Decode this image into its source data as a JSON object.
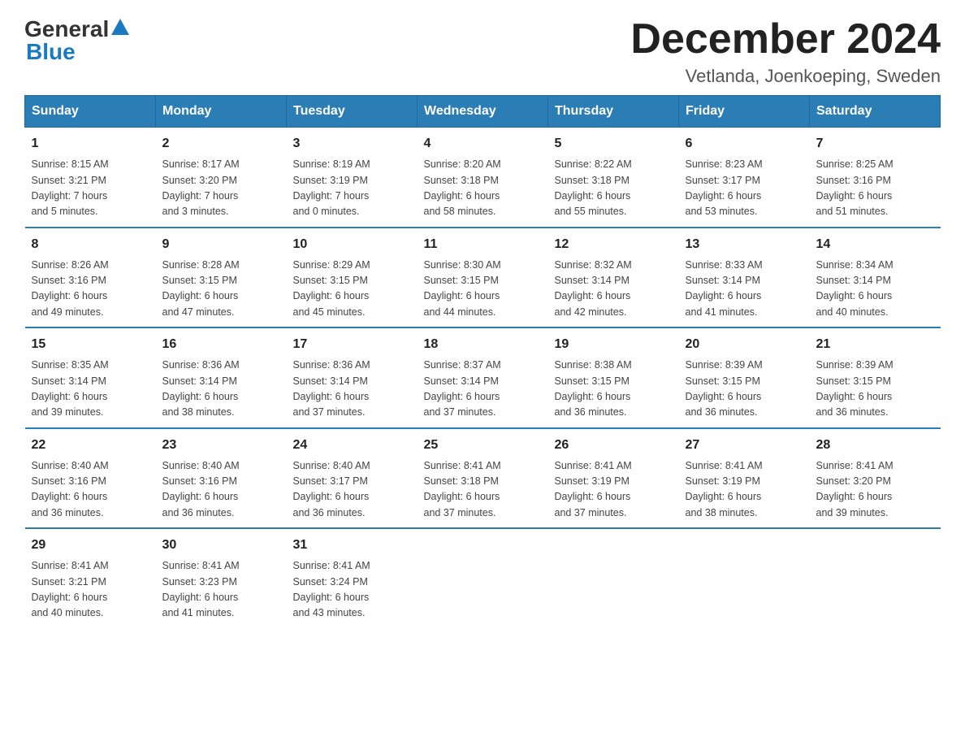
{
  "header": {
    "logo_general": "General",
    "logo_blue": "Blue",
    "month_title": "December 2024",
    "location": "Vetlanda, Joenkoeping, Sweden"
  },
  "days_of_week": [
    "Sunday",
    "Monday",
    "Tuesday",
    "Wednesday",
    "Thursday",
    "Friday",
    "Saturday"
  ],
  "weeks": [
    [
      {
        "day": "1",
        "sunrise": "8:15 AM",
        "sunset": "3:21 PM",
        "daylight": "7 hours and 5 minutes."
      },
      {
        "day": "2",
        "sunrise": "8:17 AM",
        "sunset": "3:20 PM",
        "daylight": "7 hours and 3 minutes."
      },
      {
        "day": "3",
        "sunrise": "8:19 AM",
        "sunset": "3:19 PM",
        "daylight": "7 hours and 0 minutes."
      },
      {
        "day": "4",
        "sunrise": "8:20 AM",
        "sunset": "3:18 PM",
        "daylight": "6 hours and 58 minutes."
      },
      {
        "day": "5",
        "sunrise": "8:22 AM",
        "sunset": "3:18 PM",
        "daylight": "6 hours and 55 minutes."
      },
      {
        "day": "6",
        "sunrise": "8:23 AM",
        "sunset": "3:17 PM",
        "daylight": "6 hours and 53 minutes."
      },
      {
        "day": "7",
        "sunrise": "8:25 AM",
        "sunset": "3:16 PM",
        "daylight": "6 hours and 51 minutes."
      }
    ],
    [
      {
        "day": "8",
        "sunrise": "8:26 AM",
        "sunset": "3:16 PM",
        "daylight": "6 hours and 49 minutes."
      },
      {
        "day": "9",
        "sunrise": "8:28 AM",
        "sunset": "3:15 PM",
        "daylight": "6 hours and 47 minutes."
      },
      {
        "day": "10",
        "sunrise": "8:29 AM",
        "sunset": "3:15 PM",
        "daylight": "6 hours and 45 minutes."
      },
      {
        "day": "11",
        "sunrise": "8:30 AM",
        "sunset": "3:15 PM",
        "daylight": "6 hours and 44 minutes."
      },
      {
        "day": "12",
        "sunrise": "8:32 AM",
        "sunset": "3:14 PM",
        "daylight": "6 hours and 42 minutes."
      },
      {
        "day": "13",
        "sunrise": "8:33 AM",
        "sunset": "3:14 PM",
        "daylight": "6 hours and 41 minutes."
      },
      {
        "day": "14",
        "sunrise": "8:34 AM",
        "sunset": "3:14 PM",
        "daylight": "6 hours and 40 minutes."
      }
    ],
    [
      {
        "day": "15",
        "sunrise": "8:35 AM",
        "sunset": "3:14 PM",
        "daylight": "6 hours and 39 minutes."
      },
      {
        "day": "16",
        "sunrise": "8:36 AM",
        "sunset": "3:14 PM",
        "daylight": "6 hours and 38 minutes."
      },
      {
        "day": "17",
        "sunrise": "8:36 AM",
        "sunset": "3:14 PM",
        "daylight": "6 hours and 37 minutes."
      },
      {
        "day": "18",
        "sunrise": "8:37 AM",
        "sunset": "3:14 PM",
        "daylight": "6 hours and 37 minutes."
      },
      {
        "day": "19",
        "sunrise": "8:38 AM",
        "sunset": "3:15 PM",
        "daylight": "6 hours and 36 minutes."
      },
      {
        "day": "20",
        "sunrise": "8:39 AM",
        "sunset": "3:15 PM",
        "daylight": "6 hours and 36 minutes."
      },
      {
        "day": "21",
        "sunrise": "8:39 AM",
        "sunset": "3:15 PM",
        "daylight": "6 hours and 36 minutes."
      }
    ],
    [
      {
        "day": "22",
        "sunrise": "8:40 AM",
        "sunset": "3:16 PM",
        "daylight": "6 hours and 36 minutes."
      },
      {
        "day": "23",
        "sunrise": "8:40 AM",
        "sunset": "3:16 PM",
        "daylight": "6 hours and 36 minutes."
      },
      {
        "day": "24",
        "sunrise": "8:40 AM",
        "sunset": "3:17 PM",
        "daylight": "6 hours and 36 minutes."
      },
      {
        "day": "25",
        "sunrise": "8:41 AM",
        "sunset": "3:18 PM",
        "daylight": "6 hours and 37 minutes."
      },
      {
        "day": "26",
        "sunrise": "8:41 AM",
        "sunset": "3:19 PM",
        "daylight": "6 hours and 37 minutes."
      },
      {
        "day": "27",
        "sunrise": "8:41 AM",
        "sunset": "3:19 PM",
        "daylight": "6 hours and 38 minutes."
      },
      {
        "day": "28",
        "sunrise": "8:41 AM",
        "sunset": "3:20 PM",
        "daylight": "6 hours and 39 minutes."
      }
    ],
    [
      {
        "day": "29",
        "sunrise": "8:41 AM",
        "sunset": "3:21 PM",
        "daylight": "6 hours and 40 minutes."
      },
      {
        "day": "30",
        "sunrise": "8:41 AM",
        "sunset": "3:23 PM",
        "daylight": "6 hours and 41 minutes."
      },
      {
        "day": "31",
        "sunrise": "8:41 AM",
        "sunset": "3:24 PM",
        "daylight": "6 hours and 43 minutes."
      },
      null,
      null,
      null,
      null
    ]
  ],
  "labels": {
    "sunrise": "Sunrise:",
    "sunset": "Sunset:",
    "daylight": "Daylight:"
  }
}
